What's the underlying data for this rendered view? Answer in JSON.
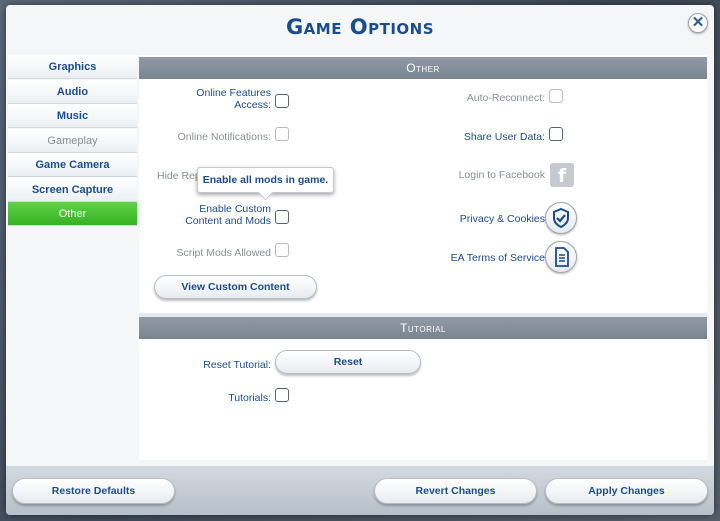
{
  "dialog": {
    "title": "Game Options",
    "close_glyph": "✕"
  },
  "sidebar": {
    "items": [
      {
        "label": "Graphics"
      },
      {
        "label": "Audio"
      },
      {
        "label": "Music"
      },
      {
        "label": "Gameplay"
      },
      {
        "label": "Game Camera"
      },
      {
        "label": "Screen Capture"
      },
      {
        "label": "Other"
      }
    ]
  },
  "other": {
    "header": "Other",
    "online_features": "Online Features Access:",
    "online_notifications": "Online Notifications:",
    "hide_rep": "Hide Rep",
    "enable_custom_content": "Enable Custom Content and Mods",
    "script_mods": "Script Mods Allowed",
    "view_custom_content": "View Custom Content",
    "auto_reconnect": "Auto-Reconnect:",
    "share_user_data": "Share User Data:",
    "login_facebook": "Login to Facebook",
    "privacy_cookies": "Privacy & Cookies",
    "ea_terms": "EA Terms of Service",
    "tooltip": "Enable all mods in game.",
    "facebook_glyph": "f"
  },
  "tutorial": {
    "header": "Tutorial",
    "reset_label": "Reset Tutorial:",
    "reset_button": "Reset",
    "tutorials_label": "Tutorials:"
  },
  "footer": {
    "restore_defaults": "Restore Defaults",
    "revert_changes": "Revert Changes",
    "apply_changes": "Apply Changes"
  },
  "colors": {
    "accent_blue": "#1b4d8a",
    "active_tab_green": "#37b122",
    "section_header_gray": "#7a8592"
  },
  "icons": {
    "close": "close-icon",
    "facebook": "facebook-icon",
    "privacy": "shield-check-icon",
    "terms": "document-icon"
  }
}
